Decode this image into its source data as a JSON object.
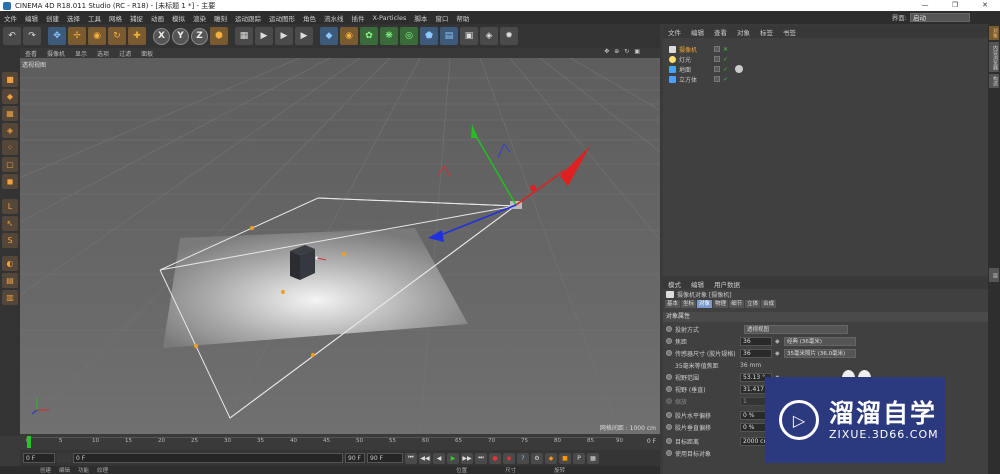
{
  "titlebar": {
    "title": "CINEMA 4D R18.011 Studio (RC - R18) - [未标题 1 *] - 主要",
    "min": "—",
    "max": "❐",
    "close": "✕"
  },
  "menubar": {
    "items": [
      "文件",
      "编辑",
      "创建",
      "选择",
      "工具",
      "网格",
      "捕捉",
      "动画",
      "模拟",
      "渲染",
      "雕刻",
      "运动跟踪",
      "运动图形",
      "角色",
      "流水线",
      "插件",
      "X-Particles",
      "脚本",
      "窗口",
      "帮助"
    ],
    "interface_label": "界面:",
    "interface_value": "启动"
  },
  "toolbar": {
    "undo": "↶",
    "redo": "↷",
    "tools": [
      "✥",
      "✢",
      "◉",
      "↻",
      "✚"
    ],
    "axes": [
      "X",
      "Y",
      "Z"
    ],
    "extra": [
      "⬢",
      "▦",
      "▶",
      "▶",
      "▶",
      "◆",
      "◉",
      "✿",
      "❋",
      "◎",
      "⬟",
      "▤",
      "▣",
      "◈",
      "✹"
    ]
  },
  "viewport": {
    "menu": [
      "查看",
      "摄像机",
      "显示",
      "选项",
      "过滤",
      "面板"
    ],
    "label": "透视视图",
    "grid_distance": "网格间距 : 1000 cm",
    "icons": [
      "✥",
      "⊕",
      "↻",
      "▣"
    ]
  },
  "timeline": {
    "ticks": [
      "0",
      "5",
      "10",
      "15",
      "20",
      "25",
      "30",
      "35",
      "40",
      "45",
      "50",
      "55",
      "60",
      "65",
      "70",
      "75",
      "80",
      "85",
      "90"
    ],
    "frame_end": "0 F"
  },
  "transport": {
    "start": "0 F",
    "current": "0 F",
    "end": "90 F",
    "end2": "90 F",
    "buttons": [
      "⏮",
      "◀◀",
      "◀",
      "▶",
      "▶▶",
      "⏭",
      "●",
      "◉",
      "?",
      "⚙",
      "◆",
      "■",
      "P",
      "▦"
    ]
  },
  "bottom_strip": {
    "items": [
      "创建",
      "编辑",
      "功能",
      "纹理"
    ],
    "right": [
      "位置",
      "尺寸",
      "旋转"
    ]
  },
  "object_manager": {
    "menu": [
      "文件",
      "编辑",
      "查看",
      "对象",
      "标签",
      "书签"
    ],
    "rows": [
      {
        "name": "摄像机",
        "color": "#e0e0e0",
        "selected": true
      },
      {
        "name": "灯光",
        "color": "#e0e0e0",
        "selected": false
      },
      {
        "name": "地面",
        "color": "#4aa0ff",
        "selected": false
      },
      {
        "name": "立方体",
        "color": "#4aa0ff",
        "selected": false
      }
    ]
  },
  "right_tabs": [
    "对象",
    "内容浏览器",
    "构造",
    "层"
  ],
  "attribute_manager": {
    "menu": [
      "模式",
      "编辑",
      "用户数据"
    ],
    "object_label": "摄像机对象 [摄像机]",
    "tabs": [
      "基本",
      "坐标",
      "对象",
      "物理",
      "细节",
      "立体",
      "合成"
    ],
    "active_tab": "对象",
    "section": "对象属性",
    "rows": [
      {
        "label": "投射方式",
        "value": "",
        "select": "透视视图"
      },
      {
        "label": "焦距",
        "value": "36",
        "select": "经典 (36毫米)"
      },
      {
        "label": "传感器尺寸 (胶片规格)",
        "value": "36",
        "select": "35毫米照片 (36.0毫米)"
      },
      {
        "label": "35毫米等值焦距",
        "value": "36 mm",
        "select": ""
      },
      {
        "label": "视野范围",
        "value": "53.13 °",
        "select": ""
      },
      {
        "label": "视野 (垂直)",
        "value": "31.417 °",
        "select": ""
      },
      {
        "label": "缩放",
        "value": "1",
        "select": ""
      },
      {
        "label": "胶片水平偏移",
        "value": "0 %",
        "select": ""
      },
      {
        "label": "胶片垂直偏移",
        "value": "0 %",
        "select": ""
      },
      {
        "label": "目标距离",
        "value": "2000 cm",
        "select": ""
      },
      {
        "label": "使用目标对象",
        "value": "",
        "select": ""
      }
    ]
  },
  "watermark": {
    "title": "溜溜自学",
    "subtitle": "ZIXUE.3D66.COM",
    "logo_glyph": "▷"
  }
}
